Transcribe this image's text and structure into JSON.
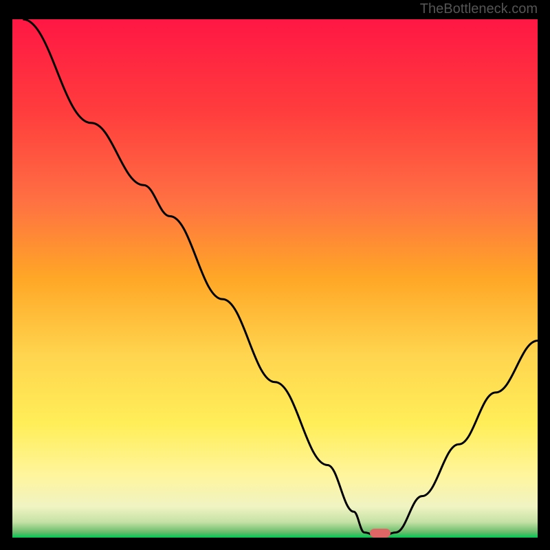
{
  "watermark": "TheBottleneck.com",
  "chart_data": {
    "type": "line",
    "title": "",
    "xlabel": "",
    "ylabel": "",
    "xlim": [
      0,
      100
    ],
    "ylim": [
      0,
      100
    ],
    "gradient_stops": [
      {
        "offset": 0,
        "color": "#ff1744"
      },
      {
        "offset": 18,
        "color": "#ff3d3d"
      },
      {
        "offset": 35,
        "color": "#ff7043"
      },
      {
        "offset": 50,
        "color": "#ffa726"
      },
      {
        "offset": 65,
        "color": "#ffd54f"
      },
      {
        "offset": 78,
        "color": "#ffee58"
      },
      {
        "offset": 88,
        "color": "#fff59d"
      },
      {
        "offset": 94,
        "color": "#f0f4c3"
      },
      {
        "offset": 97,
        "color": "#c5e1a5"
      },
      {
        "offset": 99,
        "color": "#66bb6a"
      },
      {
        "offset": 100,
        "color": "#00c853"
      }
    ],
    "curve": {
      "description": "Bottleneck curve - V shape with minimum around 68-72%",
      "points": [
        {
          "x": 2,
          "y": 100
        },
        {
          "x": 15,
          "y": 80
        },
        {
          "x": 25,
          "y": 68
        },
        {
          "x": 30,
          "y": 62
        },
        {
          "x": 40,
          "y": 46
        },
        {
          "x": 50,
          "y": 30
        },
        {
          "x": 60,
          "y": 14
        },
        {
          "x": 65,
          "y": 5
        },
        {
          "x": 67,
          "y": 1
        },
        {
          "x": 70,
          "y": 0
        },
        {
          "x": 73,
          "y": 1
        },
        {
          "x": 78,
          "y": 8
        },
        {
          "x": 85,
          "y": 18
        },
        {
          "x": 92,
          "y": 28
        },
        {
          "x": 100,
          "y": 38
        }
      ]
    },
    "marker": {
      "x": 70,
      "y": 0.5,
      "color": "#e06666"
    }
  }
}
